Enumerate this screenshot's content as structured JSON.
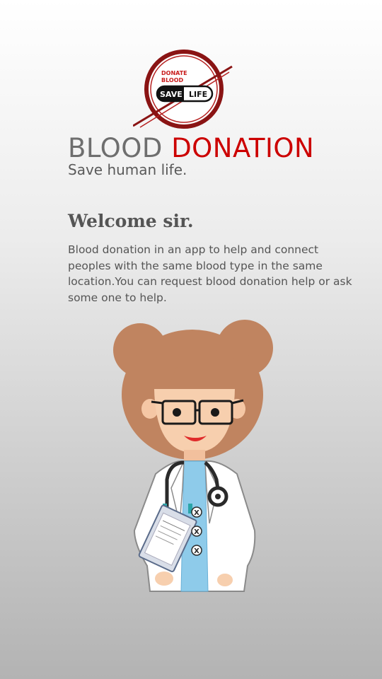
{
  "logo": {
    "line1": "DONATE",
    "line2": "BLOOD",
    "pill_left": "SAVE",
    "pill_right": "LIFE"
  },
  "header": {
    "title_part1": "BLOOD",
    "title_part2": "DONATION",
    "subtitle": "Save human life."
  },
  "welcome": {
    "heading": "Welcome sir.",
    "description": "Blood donation in an app to help and connect peoples with the same blood type in the same location.You can request blood donation help or ask some one to help."
  },
  "illustration": {
    "badge_button_label": "X"
  },
  "colors": {
    "accent": "#cc0000",
    "title_gray": "#6e6e6e",
    "text_gray": "#555555"
  }
}
